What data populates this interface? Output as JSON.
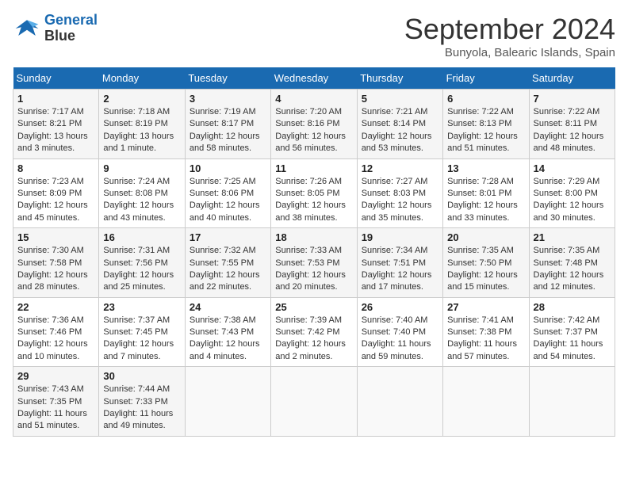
{
  "header": {
    "logo_line1": "General",
    "logo_line2": "Blue",
    "title": "September 2024",
    "subtitle": "Bunyola, Balearic Islands, Spain"
  },
  "weekdays": [
    "Sunday",
    "Monday",
    "Tuesday",
    "Wednesday",
    "Thursday",
    "Friday",
    "Saturday"
  ],
  "weeks": [
    [
      {
        "day": "1",
        "sunrise": "7:17 AM",
        "sunset": "8:21 PM",
        "daylight": "13 hours and 3 minutes."
      },
      {
        "day": "2",
        "sunrise": "7:18 AM",
        "sunset": "8:19 PM",
        "daylight": "13 hours and 1 minute."
      },
      {
        "day": "3",
        "sunrise": "7:19 AM",
        "sunset": "8:17 PM",
        "daylight": "12 hours and 58 minutes."
      },
      {
        "day": "4",
        "sunrise": "7:20 AM",
        "sunset": "8:16 PM",
        "daylight": "12 hours and 56 minutes."
      },
      {
        "day": "5",
        "sunrise": "7:21 AM",
        "sunset": "8:14 PM",
        "daylight": "12 hours and 53 minutes."
      },
      {
        "day": "6",
        "sunrise": "7:22 AM",
        "sunset": "8:13 PM",
        "daylight": "12 hours and 51 minutes."
      },
      {
        "day": "7",
        "sunrise": "7:22 AM",
        "sunset": "8:11 PM",
        "daylight": "12 hours and 48 minutes."
      }
    ],
    [
      {
        "day": "8",
        "sunrise": "7:23 AM",
        "sunset": "8:09 PM",
        "daylight": "12 hours and 45 minutes."
      },
      {
        "day": "9",
        "sunrise": "7:24 AM",
        "sunset": "8:08 PM",
        "daylight": "12 hours and 43 minutes."
      },
      {
        "day": "10",
        "sunrise": "7:25 AM",
        "sunset": "8:06 PM",
        "daylight": "12 hours and 40 minutes."
      },
      {
        "day": "11",
        "sunrise": "7:26 AM",
        "sunset": "8:05 PM",
        "daylight": "12 hours and 38 minutes."
      },
      {
        "day": "12",
        "sunrise": "7:27 AM",
        "sunset": "8:03 PM",
        "daylight": "12 hours and 35 minutes."
      },
      {
        "day": "13",
        "sunrise": "7:28 AM",
        "sunset": "8:01 PM",
        "daylight": "12 hours and 33 minutes."
      },
      {
        "day": "14",
        "sunrise": "7:29 AM",
        "sunset": "8:00 PM",
        "daylight": "12 hours and 30 minutes."
      }
    ],
    [
      {
        "day": "15",
        "sunrise": "7:30 AM",
        "sunset": "7:58 PM",
        "daylight": "12 hours and 28 minutes."
      },
      {
        "day": "16",
        "sunrise": "7:31 AM",
        "sunset": "7:56 PM",
        "daylight": "12 hours and 25 minutes."
      },
      {
        "day": "17",
        "sunrise": "7:32 AM",
        "sunset": "7:55 PM",
        "daylight": "12 hours and 22 minutes."
      },
      {
        "day": "18",
        "sunrise": "7:33 AM",
        "sunset": "7:53 PM",
        "daylight": "12 hours and 20 minutes."
      },
      {
        "day": "19",
        "sunrise": "7:34 AM",
        "sunset": "7:51 PM",
        "daylight": "12 hours and 17 minutes."
      },
      {
        "day": "20",
        "sunrise": "7:35 AM",
        "sunset": "7:50 PM",
        "daylight": "12 hours and 15 minutes."
      },
      {
        "day": "21",
        "sunrise": "7:35 AM",
        "sunset": "7:48 PM",
        "daylight": "12 hours and 12 minutes."
      }
    ],
    [
      {
        "day": "22",
        "sunrise": "7:36 AM",
        "sunset": "7:46 PM",
        "daylight": "12 hours and 10 minutes."
      },
      {
        "day": "23",
        "sunrise": "7:37 AM",
        "sunset": "7:45 PM",
        "daylight": "12 hours and 7 minutes."
      },
      {
        "day": "24",
        "sunrise": "7:38 AM",
        "sunset": "7:43 PM",
        "daylight": "12 hours and 4 minutes."
      },
      {
        "day": "25",
        "sunrise": "7:39 AM",
        "sunset": "7:42 PM",
        "daylight": "12 hours and 2 minutes."
      },
      {
        "day": "26",
        "sunrise": "7:40 AM",
        "sunset": "7:40 PM",
        "daylight": "11 hours and 59 minutes."
      },
      {
        "day": "27",
        "sunrise": "7:41 AM",
        "sunset": "7:38 PM",
        "daylight": "11 hours and 57 minutes."
      },
      {
        "day": "28",
        "sunrise": "7:42 AM",
        "sunset": "7:37 PM",
        "daylight": "11 hours and 54 minutes."
      }
    ],
    [
      {
        "day": "29",
        "sunrise": "7:43 AM",
        "sunset": "7:35 PM",
        "daylight": "11 hours and 51 minutes."
      },
      {
        "day": "30",
        "sunrise": "7:44 AM",
        "sunset": "7:33 PM",
        "daylight": "11 hours and 49 minutes."
      },
      null,
      null,
      null,
      null,
      null
    ]
  ]
}
